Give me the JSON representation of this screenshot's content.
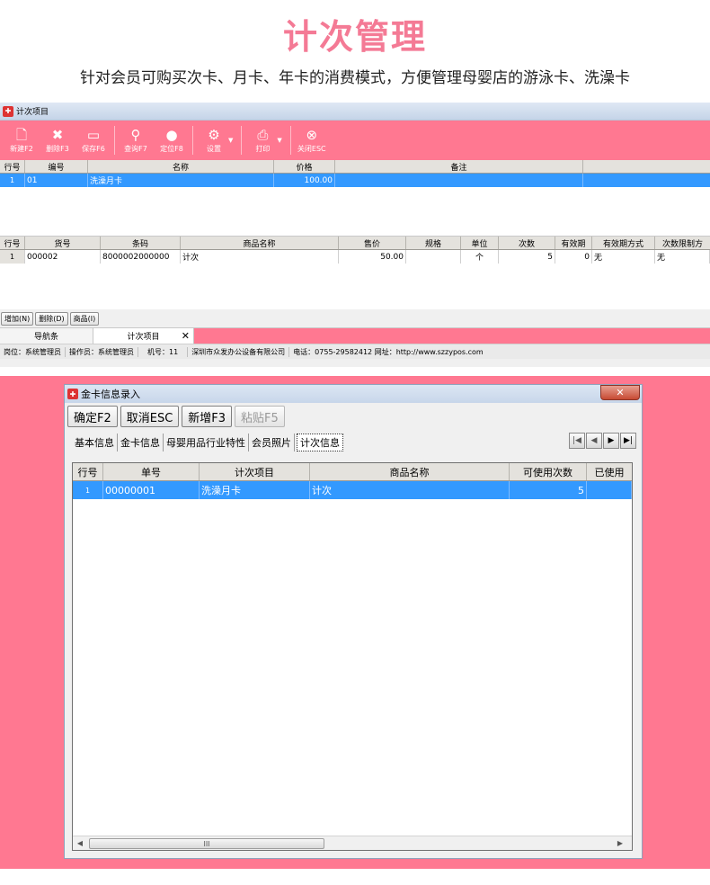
{
  "hero": {
    "title": "计次管理",
    "subtitle": "针对会员可购买次卡、月卡、年卡的消费模式，方便管理母婴店的游泳卡、洗澡卡"
  },
  "app1": {
    "window_title": "计次项目",
    "toolbar": [
      {
        "label": "新建F2",
        "icon": "new-file-icon"
      },
      {
        "label": "删除F3",
        "icon": "delete-x-icon"
      },
      {
        "label": "保存F6",
        "icon": "save-icon"
      },
      {
        "label": "查询F7",
        "icon": "search-icon"
      },
      {
        "label": "定位F8",
        "icon": "locate-pin-icon"
      },
      {
        "label": "设置",
        "icon": "gear-icon"
      },
      {
        "label": "打印",
        "icon": "printer-icon"
      },
      {
        "label": "关闭ESC",
        "icon": "close-circle-icon"
      }
    ],
    "grid1": {
      "headers": [
        "行号",
        "编号",
        "名称",
        "价格",
        "备注"
      ],
      "rows": [
        [
          "1",
          "01",
          "洗澡月卡",
          "100.00",
          ""
        ]
      ]
    },
    "grid2": {
      "headers": [
        "行号",
        "货号",
        "条码",
        "商品名称",
        "售价",
        "规格",
        "单位",
        "次数",
        "有效期",
        "有效期方式",
        "次数限制方"
      ],
      "rows": [
        [
          "1",
          "000002",
          "8000002000000",
          "计次",
          "50.00",
          "",
          "个",
          "5",
          "0",
          "无",
          "无"
        ]
      ]
    },
    "bottom_buttons": [
      "增加(N)",
      "删除(D)",
      "商品(I)"
    ],
    "nav_tabs": [
      "导航条",
      "计次项目"
    ],
    "status": [
      "岗位：系统管理员",
      "操作员：系统管理员",
      "机号：11",
      "深圳市众发办公设备有限公司",
      "电话：0755-29582412  网址：http://www.szzypos.com"
    ]
  },
  "dialog": {
    "title": "金卡信息录入",
    "buttons": {
      "ok": "确定F2",
      "cancel": "取消ESC",
      "new": "新增F3",
      "paste": "粘贴F5"
    },
    "tabs": [
      "基本信息",
      "金卡信息",
      "母婴用品行业特性",
      "会员照片",
      "计次信息"
    ],
    "grid": {
      "headers": [
        "行号",
        "单号",
        "计次项目",
        "商品名称",
        "可使用次数",
        "已使用"
      ],
      "rows": [
        [
          "1",
          "00000001",
          "洗澡月卡",
          "计次",
          "5",
          ""
        ]
      ]
    },
    "scroll_thumb_text": "III"
  },
  "colors": {
    "accent": "#ff7891",
    "title_pink": "#f47a95",
    "selection": "#3399ff"
  }
}
